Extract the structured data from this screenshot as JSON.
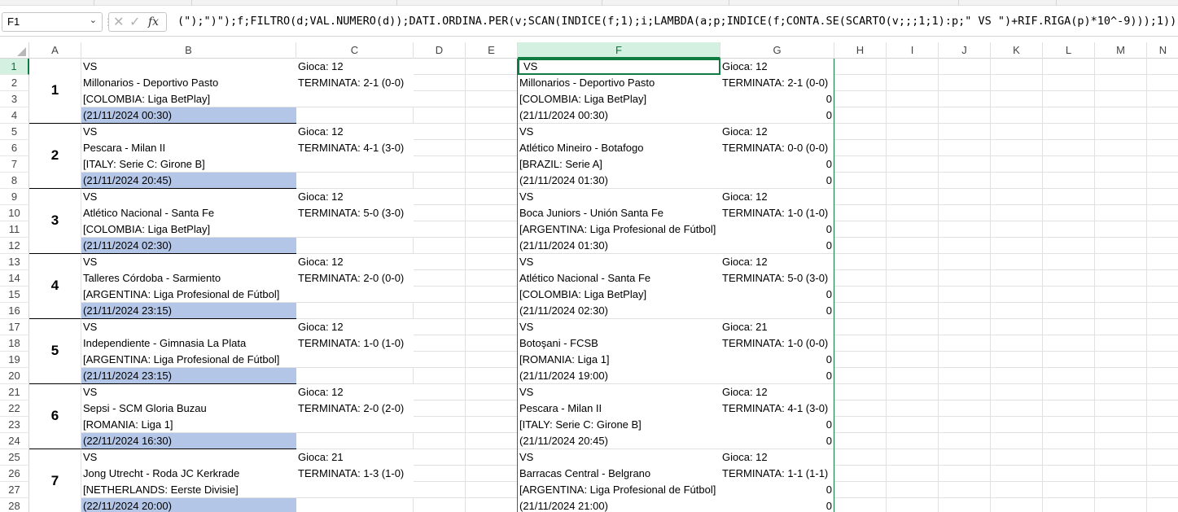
{
  "namebox": {
    "value": "F1"
  },
  "formula": {
    "text": "(\");\")\");f;FILTRO(d;VAL.NUMERO(d));DATI.ORDINA.PER(v;SCAN(INDICE(f;1);i;LAMBDA(a;p;INDICE(f;CONTA.SE(SCARTO(v;;;1;1):p;\" VS \")+RIF.RIGA(p)*10^-9)));1))"
  },
  "columns": [
    "A",
    "B",
    "C",
    "D",
    "E",
    "F",
    "G",
    "H",
    "I",
    "J",
    "K",
    "L",
    "M",
    "N"
  ],
  "rows": [
    "1",
    "2",
    "3",
    "4",
    "5",
    "6",
    "7",
    "8",
    "9",
    "10",
    "11",
    "12",
    "13",
    "14",
    "15",
    "16",
    "17",
    "18",
    "19",
    "20",
    "21",
    "22",
    "23",
    "24",
    "25",
    "26",
    "27",
    "28"
  ],
  "left_blocks": [
    {
      "num": "1",
      "vs": "VS",
      "gioca": "Gioca: 12",
      "match": "Millonarios - Deportivo Pasto",
      "result": "TERMINATA: 2-1  (0-0)",
      "league": "[COLOMBIA: Liga BetPlay]",
      "date": "(21/11/2024 00:30)"
    },
    {
      "num": "2",
      "vs": "VS",
      "gioca": "Gioca: 12",
      "match": "Pescara - Milan II",
      "result": "TERMINATA: 4-1  (3-0)",
      "league": "[ITALY: Serie C: Girone B]",
      "date": "(21/11/2024 20:45)"
    },
    {
      "num": "3",
      "vs": "VS",
      "gioca": "Gioca: 12",
      "match": "Atlético Nacional - Santa Fe",
      "result": "TERMINATA: 5-0  (3-0)",
      "league": "[COLOMBIA: Liga BetPlay]",
      "date": "(21/11/2024 02:30)"
    },
    {
      "num": "4",
      "vs": "VS",
      "gioca": "Gioca: 12",
      "match": "Talleres Córdoba - Sarmiento",
      "result": "TERMINATA: 2-0  (0-0)",
      "league": "[ARGENTINA: Liga Profesional de Fútbol]",
      "date": "(21/11/2024 23:15)"
    },
    {
      "num": "5",
      "vs": "VS",
      "gioca": "Gioca: 12",
      "match": "Independiente - Gimnasia La Plata",
      "result": "TERMINATA: 1-0  (1-0)",
      "league": "[ARGENTINA: Liga Profesional de Fútbol]",
      "date": "(21/11/2024 23:15)"
    },
    {
      "num": "6",
      "vs": "VS",
      "gioca": "Gioca: 12",
      "match": "Sepsi - SCM Gloria Buzau",
      "result": "TERMINATA: 2-0  (2-0)",
      "league": "[ROMANIA: Liga 1]",
      "date": "(22/11/2024 16:30)"
    },
    {
      "num": "7",
      "vs": "VS",
      "gioca": "Gioca: 21",
      "match": "Jong Utrecht - Roda JC Kerkrade",
      "result": "TERMINATA: 1-3  (1-0)",
      "league": "[NETHERLANDS: Eerste Divisie]",
      "date": "(22/11/2024 20:00)"
    }
  ],
  "right_blocks": [
    {
      "vs": "VS",
      "gioca": "Gioca: 12",
      "match": "Millonarios - Deportivo Pasto",
      "result": "TERMINATA: 2-1  (0-0)",
      "league": "[COLOMBIA: Liga BetPlay]",
      "date": "(21/11/2024 00:30)",
      "z1": "0",
      "z2": "0"
    },
    {
      "vs": "VS",
      "gioca": "Gioca: 12",
      "match": "Atlético Mineiro - Botafogo",
      "result": "TERMINATA: 0-0  (0-0)",
      "league": "[BRAZIL: Serie A]",
      "date": "(21/11/2024 01:30)",
      "z1": "0",
      "z2": "0"
    },
    {
      "vs": "VS",
      "gioca": "Gioca: 12",
      "match": "Boca Juniors - Unión Santa Fe",
      "result": "TERMINATA: 1-0  (1-0)",
      "league": "[ARGENTINA: Liga Profesional de Fútbol]",
      "date": "(21/11/2024 01:30)",
      "z1": "0",
      "z2": "0"
    },
    {
      "vs": "VS",
      "gioca": "Gioca: 12",
      "match": "Atlético Nacional - Santa Fe",
      "result": "TERMINATA: 5-0  (3-0)",
      "league": "[COLOMBIA: Liga BetPlay]",
      "date": "(21/11/2024 02:30)",
      "z1": "0",
      "z2": "0"
    },
    {
      "vs": "VS",
      "gioca": "Gioca: 21",
      "match": "Botoşani - FCSB",
      "result": "TERMINATA: 1-0  (0-0)",
      "league": "[ROMANIA: Liga 1]",
      "date": "(21/11/2024 19:00)",
      "z1": "0",
      "z2": "0"
    },
    {
      "vs": "VS",
      "gioca": "Gioca: 12",
      "match": "Pescara - Milan II",
      "result": "TERMINATA: 4-1  (3-0)",
      "league": "[ITALY: Serie C: Girone B]",
      "date": "(21/11/2024 20:45)",
      "z1": "0",
      "z2": "0"
    },
    {
      "vs": "VS",
      "gioca": "Gioca: 12",
      "match": "Barracas Central - Belgrano",
      "result": "TERMINATA: 1-1  (1-1)",
      "league": "[ARGENTINA: Liga Profesional de Fútbol]",
      "date": "(21/11/2024 21:00)",
      "z1": "0",
      "z2": "0"
    }
  ],
  "colors": {
    "accent": "#107c41",
    "blue_fill": "#b4c6e7",
    "header_active": "#d3f0e0"
  }
}
